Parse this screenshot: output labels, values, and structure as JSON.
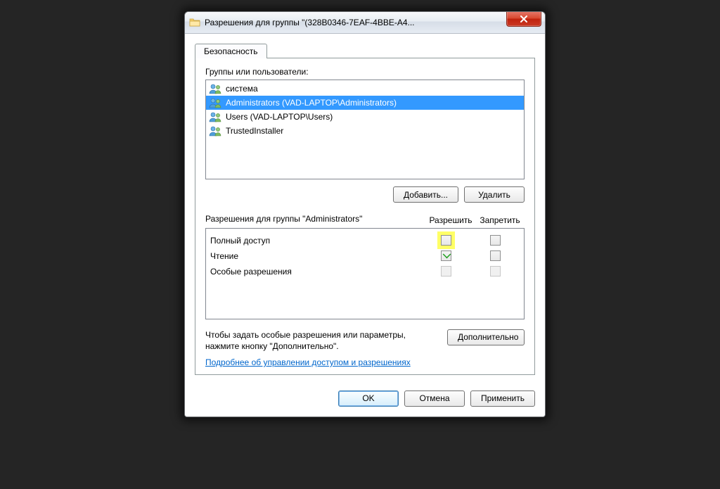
{
  "title": "Разрешения для группы \"(328B0346-7EAF-4BBE-A4...",
  "tab": {
    "security": "Безопасность"
  },
  "groups_label": "Группы или пользователи:",
  "users": [
    {
      "name": "система",
      "selected": false
    },
    {
      "name": "Administrators (VAD-LAPTOP\\Administrators)",
      "selected": true
    },
    {
      "name": "Users (VAD-LAPTOP\\Users)",
      "selected": false
    },
    {
      "name": "TrustedInstaller",
      "selected": false
    }
  ],
  "buttons": {
    "add": "Добавить...",
    "remove": "Удалить",
    "advanced": "Дополнительно",
    "ok": "OK",
    "cancel": "Отмена",
    "apply": "Применить"
  },
  "perm_for_label": "Разрешения для группы \"Administrators\"",
  "col_allow": "Разрешить",
  "col_deny": "Запретить",
  "perms": [
    {
      "name": "Полный доступ",
      "allow": "highlight",
      "deny": "off"
    },
    {
      "name": "Чтение",
      "allow": "on",
      "deny": "off"
    },
    {
      "name": "Особые разрешения",
      "allow": "disabled",
      "deny": "disabled"
    }
  ],
  "advanced_text": "Чтобы задать особые разрешения или параметры, нажмите кнопку \"Дополнительно\".",
  "help_link": "Подробнее об управлении доступом и разрешениях "
}
